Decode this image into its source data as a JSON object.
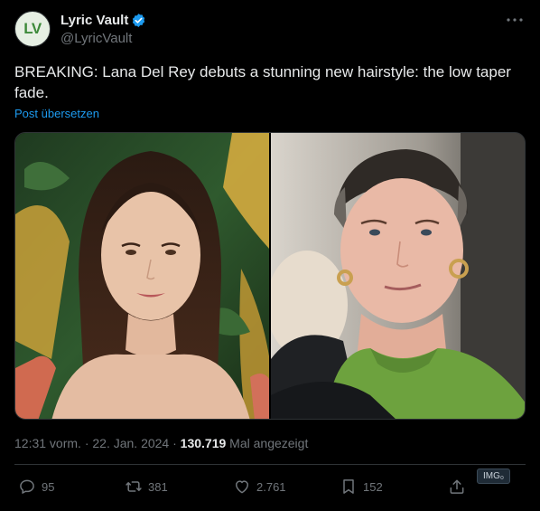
{
  "account": {
    "display_name": "Lyric Vault",
    "handle": "@LyricVault",
    "avatar_text": "LV"
  },
  "tweet": {
    "text": "BREAKING: Lana Del Rey debuts a stunning new hairstyle: the low taper fade.",
    "translate_label": "Post übersetzen",
    "timestamp": "12:31 vorm. · 22. Jan. 2024",
    "separator": " · ",
    "views_count": "130.719",
    "views_label": " Mal angezeigt"
  },
  "actions": {
    "replies": "95",
    "reposts": "381",
    "likes": "2.761",
    "bookmarks": "152"
  },
  "overlay_badge": "IMG₀",
  "icons": {
    "verified": "verified-badge-icon",
    "more": "more-icon",
    "reply": "reply-icon",
    "repost": "repost-icon",
    "like": "like-icon",
    "bookmark": "bookmark-icon",
    "share": "share-icon"
  },
  "colors": {
    "background": "#000000",
    "text": "#e7e9ea",
    "secondary": "#71767b",
    "link": "#1d9bf0",
    "border": "#2f3336"
  }
}
